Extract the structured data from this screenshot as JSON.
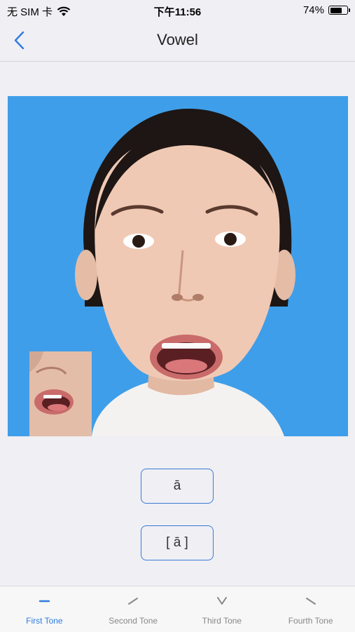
{
  "status_bar": {
    "carrier": "无 SIM 卡",
    "time": "下午11:56",
    "battery_percent_text": "74%",
    "battery_level": 0.74
  },
  "nav": {
    "back_icon": "chevron-left-icon",
    "title": "Vowel"
  },
  "video": {
    "background_color": "#3f9ee9"
  },
  "pronunciation": {
    "pinyin": "ā",
    "ipa": "[ ā ]"
  },
  "tabs": [
    {
      "label": "First Tone",
      "icon": "flat-tone-icon",
      "active": true
    },
    {
      "label": "Second Tone",
      "icon": "rising-tone-icon",
      "active": false
    },
    {
      "label": "Third Tone",
      "icon": "dipping-tone-icon",
      "active": false
    },
    {
      "label": "Fourth Tone",
      "icon": "falling-tone-icon",
      "active": false
    }
  ],
  "colors": {
    "accent": "#2f7be0",
    "inactive": "#888888"
  }
}
